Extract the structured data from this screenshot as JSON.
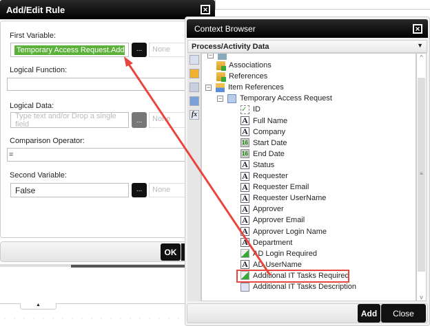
{
  "rule_dialog": {
    "title": "Add/Edit Rule",
    "first_variable": {
      "label": "First Variable:",
      "value": "Temporary Access Request.Additional IT Tasks Required",
      "browse": "...",
      "qualifier": "None"
    },
    "logical_function": {
      "label": "Logical Function:",
      "value": ""
    },
    "logical_data": {
      "label": "Logical Data:",
      "placeholder": "Type text and/or Drop a single field",
      "browse": "...",
      "qualifier": "None"
    },
    "comparison_operator": {
      "label": "Comparison Operator:",
      "value": "="
    },
    "second_variable": {
      "label": "Second Variable:",
      "value": "False",
      "browse": "...",
      "qualifier": "None"
    },
    "ok": "OK"
  },
  "context_browser": {
    "title": "Context Browser",
    "section": "Process/Activity Data",
    "tree": [
      {
        "label": "Associations",
        "icon": "folder-icon",
        "indent": 1
      },
      {
        "label": "References",
        "icon": "folder-icon",
        "indent": 1
      },
      {
        "label": "Item References",
        "icon": "item-references-icon",
        "indent": 1,
        "expanded": true
      },
      {
        "label": "Temporary Access Request",
        "icon": "list-icon",
        "indent": 2,
        "expanded": true
      },
      {
        "label": "ID",
        "icon": "id-icon",
        "indent": 3
      },
      {
        "label": "Full Name",
        "icon": "text-icon",
        "indent": 3
      },
      {
        "label": "Company",
        "icon": "text-icon",
        "indent": 3
      },
      {
        "label": "Start Date",
        "icon": "date-icon",
        "indent": 3
      },
      {
        "label": "End Date",
        "icon": "date-icon",
        "indent": 3
      },
      {
        "label": "Status",
        "icon": "text-icon",
        "indent": 3
      },
      {
        "label": "Requester",
        "icon": "text-icon",
        "indent": 3
      },
      {
        "label": "Requester Email",
        "icon": "text-icon",
        "indent": 3
      },
      {
        "label": "Requester UserName",
        "icon": "text-icon",
        "indent": 3
      },
      {
        "label": "Approver",
        "icon": "text-icon",
        "indent": 3
      },
      {
        "label": "Approver Email",
        "icon": "text-icon",
        "indent": 3
      },
      {
        "label": "Approver Login Name",
        "icon": "text-icon",
        "indent": 3
      },
      {
        "label": "Department",
        "icon": "text-icon",
        "indent": 3
      },
      {
        "label": "AD Login Required",
        "icon": "boolean-icon",
        "indent": 3
      },
      {
        "label": "AD UserName",
        "icon": "text-icon",
        "indent": 3
      },
      {
        "label": "Additional IT Tasks Required",
        "icon": "boolean-icon",
        "indent": 3,
        "highlighted": true
      },
      {
        "label": "Additional IT Tasks Description",
        "icon": "note-icon",
        "indent": 3
      }
    ],
    "add": "Add",
    "close": "Close"
  },
  "colors": {
    "accent_green": "#5cb13a",
    "arrow_red": "#e8453c"
  }
}
